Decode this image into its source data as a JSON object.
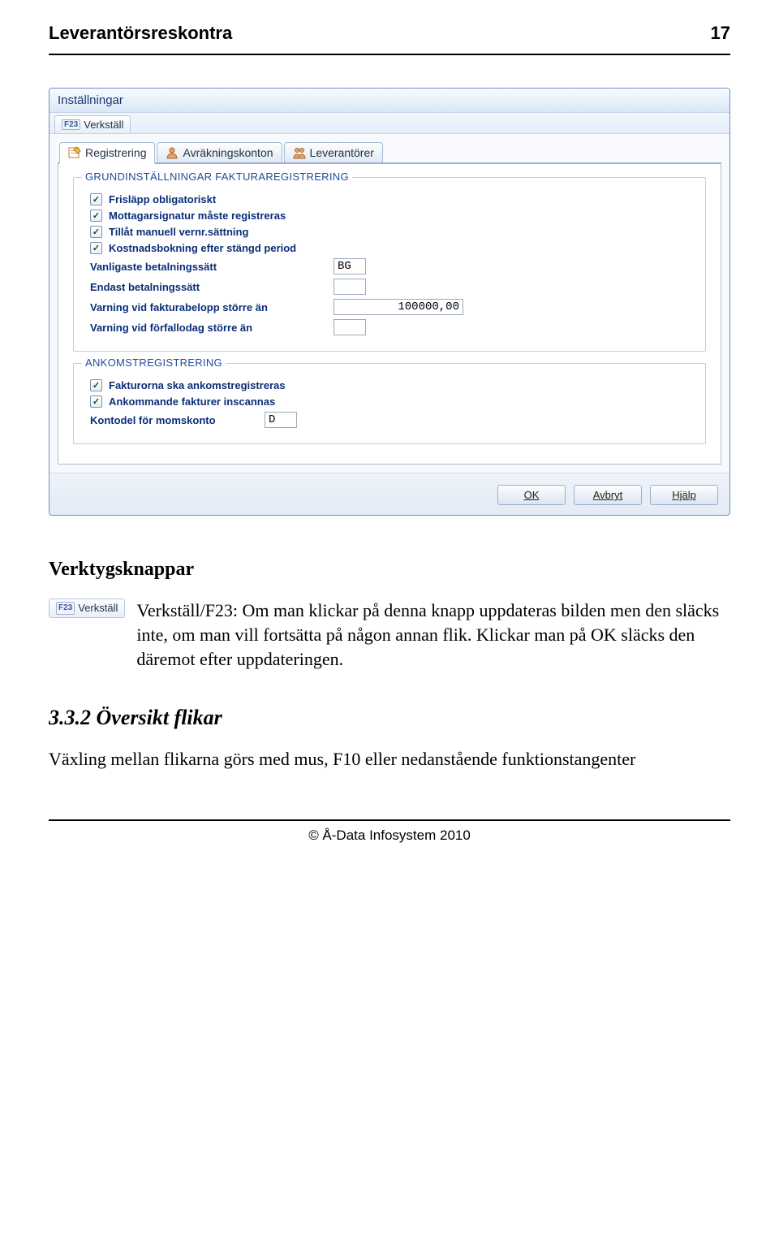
{
  "header": {
    "title": "Leverantörsreskontra",
    "page": "17"
  },
  "window": {
    "title": "Inställningar",
    "toolbar": {
      "fkey": "F23",
      "label": "Verkställ"
    },
    "tabs": [
      {
        "label": "Registrering",
        "icon": "form-icon",
        "active": true
      },
      {
        "label": "Avräkningskonton",
        "icon": "person-icon",
        "active": false
      },
      {
        "label": "Leverantörer",
        "icon": "people-icon",
        "active": false
      }
    ],
    "group1": {
      "title": "GRUNDINSTÄLLNINGAR FAKTURAREGISTRERING",
      "checks": [
        {
          "label": "Frisläpp obligatoriskt",
          "checked": true
        },
        {
          "label": "Mottagarsignatur måste registreras",
          "checked": true
        },
        {
          "label": "Tillåt manuell vernr.sättning",
          "checked": true
        },
        {
          "label": "Kostnadsbokning efter stängd period",
          "checked": true
        }
      ],
      "fields": [
        {
          "label": "Vanligaste betalningssätt",
          "value": "BG",
          "size": "sm"
        },
        {
          "label": "Endast betalningssätt",
          "value": "",
          "size": "empty"
        },
        {
          "label": "Varning vid fakturabelopp större än",
          "value": "100000,00",
          "size": "md"
        },
        {
          "label": "Varning vid förfallodag större än",
          "value": "",
          "size": "empty"
        }
      ]
    },
    "group2": {
      "title": "ANKOMSTREGISTRERING",
      "checks": [
        {
          "label": "Fakturorna ska ankomstregistreras",
          "checked": true
        },
        {
          "label": "Ankommande fakturer inscannas",
          "checked": true
        }
      ],
      "field": {
        "label": "Kontodel för momskonto",
        "value": "D"
      }
    },
    "buttons": {
      "ok": "OK",
      "cancel": "Avbryt",
      "help": "Hjälp"
    }
  },
  "body": {
    "heading1": "Verktygsknappar",
    "verk_fkey": "F23",
    "verk_label": "Verkställ",
    "verk_desc": "Verkställ/F23: Om man klickar på denna knapp uppdateras bilden men den släcks inte, om man vill fortsätta på någon annan flik. Klickar man på OK släcks den däremot efter uppdateringen.",
    "heading2_num": "3.3.2",
    "heading2_title": "Översikt flikar",
    "para2": "Växling mellan flikarna görs med mus, F10 eller nedanstående funktionstangenter"
  },
  "footer": {
    "text": "© Å-Data Infosystem 2010"
  }
}
